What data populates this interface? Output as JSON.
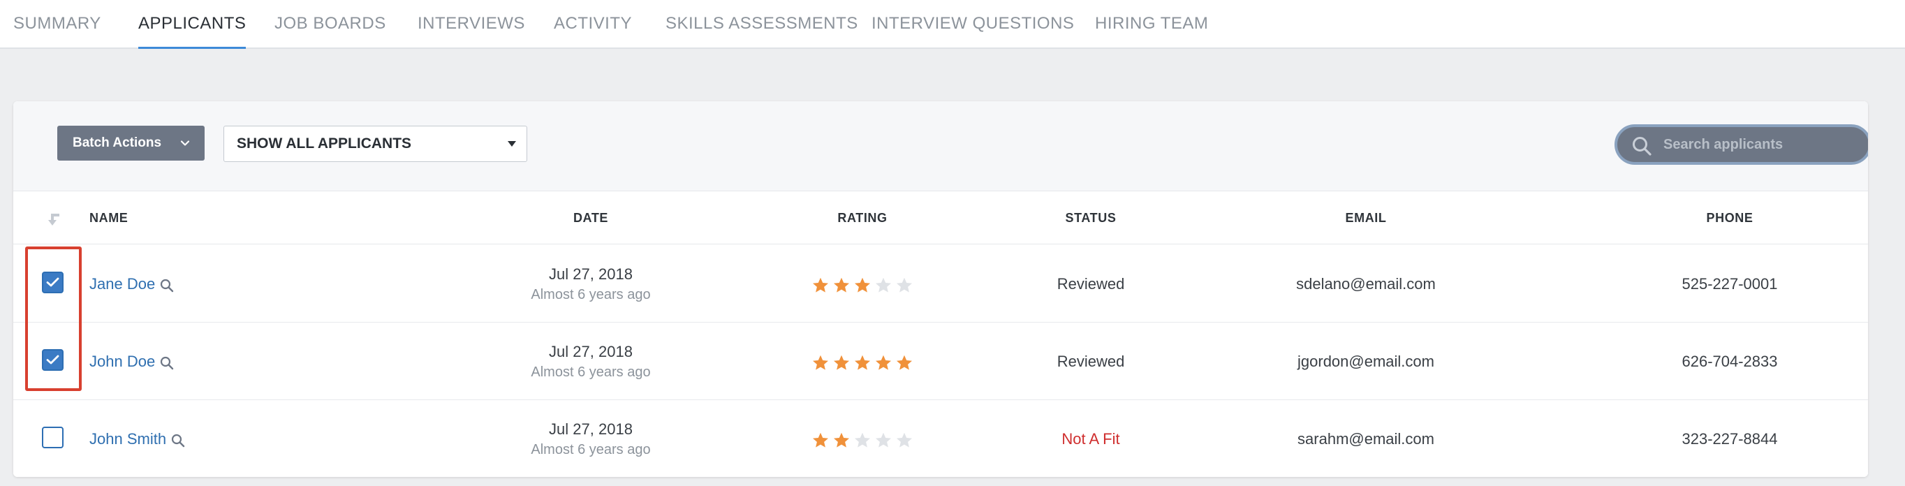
{
  "tabs": [
    {
      "label": "SUMMARY",
      "active": false
    },
    {
      "label": "APPLICANTS",
      "active": true
    },
    {
      "label": "JOB BOARDS",
      "active": false
    },
    {
      "label": "INTERVIEWS",
      "active": false
    },
    {
      "label": "ACTIVITY",
      "active": false
    },
    {
      "label": "SKILLS ASSESSMENTS",
      "active": false
    },
    {
      "label": "INTERVIEW QUESTIONS",
      "active": false
    },
    {
      "label": "HIRING TEAM",
      "active": false
    }
  ],
  "toolbar": {
    "batch_label": "Batch Actions",
    "filter_value": "SHOW ALL APPLICANTS",
    "search_placeholder": "Search applicants"
  },
  "columns": {
    "name": "NAME",
    "date": "DATE",
    "rating": "RATING",
    "status": "STATUS",
    "email": "EMAIL",
    "phone": "PHONE"
  },
  "applicants": [
    {
      "name": "Jane Doe",
      "date": "Jul 27, 2018",
      "date_ago": "Almost 6 years ago",
      "rating": 3,
      "rating_max": 5,
      "status": "Reviewed",
      "email": "sdelano@email.com",
      "phone": "525-227-0001",
      "checked": true
    },
    {
      "name": "John Doe",
      "date": "Jul 27, 2018",
      "date_ago": "Almost 6 years ago",
      "rating": 5,
      "rating_max": 5,
      "status": "Reviewed",
      "email": "jgordon@email.com",
      "phone": "626-704-2833",
      "checked": true
    },
    {
      "name": "John Smith",
      "date": "Jul 27, 2018",
      "date_ago": "Almost 6 years ago",
      "rating": 2,
      "rating_max": 5,
      "status": "Not A Fit",
      "email": "sarahm@email.com",
      "phone": "323-227-8844",
      "checked": false
    }
  ],
  "colors": {
    "accent": "#3d8ad8",
    "link": "#2f6fb0",
    "star_filled": "#f0913a",
    "star_empty": "#dfe2e6",
    "status_not_fit": "#cf2e2e",
    "highlight": "#d8402f"
  },
  "icons": {
    "batch_chevron": "chevron-down-icon",
    "filter_caret": "caret-down-icon",
    "search": "search-icon",
    "sort": "sort-icon",
    "name_preview": "magnifier-icon",
    "rating": "star-icon"
  }
}
